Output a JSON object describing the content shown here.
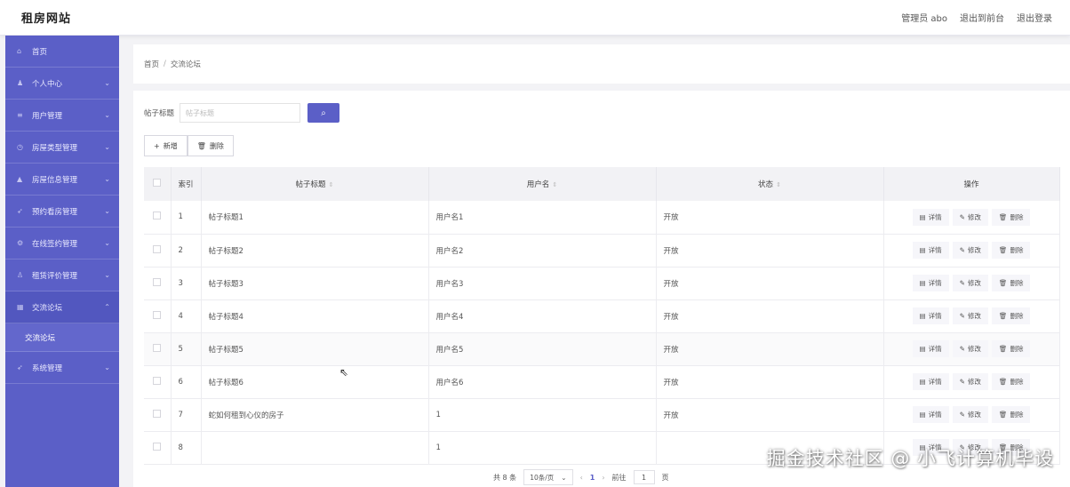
{
  "header": {
    "title": "租房网站",
    "links": [
      "管理员 abo",
      "退出到前台",
      "退出登录"
    ]
  },
  "sidebar": {
    "items": [
      {
        "label": "首页",
        "icon": "home-icon",
        "arrow": ""
      },
      {
        "label": "个人中心",
        "icon": "user-icon",
        "arrow": "⌄"
      },
      {
        "label": "用户管理",
        "icon": "list-icon",
        "arrow": "⌄"
      },
      {
        "label": "房屋类型管理",
        "icon": "clock-icon",
        "arrow": "⌄"
      },
      {
        "label": "房屋信息管理",
        "icon": "house-icon",
        "arrow": "⌄"
      },
      {
        "label": "预约看房管理",
        "icon": "send-icon",
        "arrow": "⌄"
      },
      {
        "label": "在线签约管理",
        "icon": "settings-icon",
        "arrow": "⌄"
      },
      {
        "label": "租赁评价管理",
        "icon": "person-icon",
        "arrow": "⌄"
      },
      {
        "label": "交流论坛",
        "icon": "forum-icon",
        "arrow": "⌃"
      },
      {
        "label": "系统管理",
        "icon": "send-icon",
        "arrow": "⌄"
      }
    ],
    "sub_item": "交流论坛"
  },
  "breadcrumb": {
    "home": "首页",
    "sep": "/",
    "current": "交流论坛"
  },
  "search": {
    "label": "帖子标题",
    "placeholder": "帖子标题"
  },
  "toolbar": {
    "add_label": "新增",
    "delete_label": "删除"
  },
  "table": {
    "columns": {
      "index": "索引",
      "title": "帖子标题",
      "user": "用户名",
      "status": "状态",
      "ops": "操作"
    },
    "ops": {
      "detail": "详情",
      "edit": "修改",
      "delete": "删除"
    },
    "rows": [
      {
        "idx": "1",
        "title": "帖子标题1",
        "user": "用户名1",
        "status": "开放"
      },
      {
        "idx": "2",
        "title": "帖子标题2",
        "user": "用户名2",
        "status": "开放"
      },
      {
        "idx": "3",
        "title": "帖子标题3",
        "user": "用户名3",
        "status": "开放"
      },
      {
        "idx": "4",
        "title": "帖子标题4",
        "user": "用户名4",
        "status": "开放"
      },
      {
        "idx": "5",
        "title": "帖子标题5",
        "user": "用户名5",
        "status": "开放"
      },
      {
        "idx": "6",
        "title": "帖子标题6",
        "user": "用户名6",
        "status": "开放"
      },
      {
        "idx": "7",
        "title": "蛇如何租到心仪的房子",
        "user": "1",
        "status": "开放"
      },
      {
        "idx": "8",
        "title": "",
        "user": "1",
        "status": ""
      }
    ]
  },
  "pagination": {
    "total": "共 8 条",
    "page_size": "10条/页",
    "prev": "‹",
    "page": "1",
    "next": "›",
    "goto_label": "前往",
    "goto_value": "1",
    "page_unit": "页"
  },
  "watermark": "掘金技术社区 @ 小飞计算机毕设",
  "colors": {
    "accent": "#5b5fc7",
    "sidebar": "#5b5fc7"
  }
}
